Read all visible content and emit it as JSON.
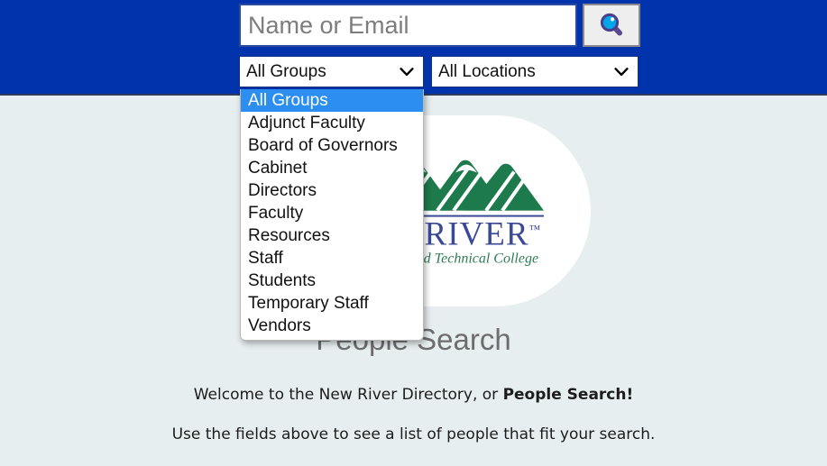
{
  "theme": {
    "header_bg": "#0033ac",
    "body_bg": "#e7eef0",
    "highlight_blue": "#2b8ef0",
    "logo_green": "#1d7a4c",
    "logo_navy": "#3b4a96",
    "title_grey": "#6d6d6d"
  },
  "search": {
    "placeholder": "Name or Email",
    "value": "",
    "button_icon": "magnifier-icon"
  },
  "filters": {
    "groups": {
      "selected": "All Groups",
      "expanded": true,
      "options": [
        "All Groups",
        "Adjunct Faculty",
        "Board of Governors",
        "Cabinet",
        "Directors",
        "Faculty",
        "Resources",
        "Staff",
        "Students",
        "Temporary Staff",
        "Vendors"
      ]
    },
    "locations": {
      "selected": "All Locations",
      "expanded": false,
      "options": [
        "All Locations"
      ]
    }
  },
  "logo": {
    "icon": "mountain-range-icon",
    "wordmark": "NEW RIVER",
    "trademark": "™",
    "tagline": "Community and Technical College"
  },
  "main": {
    "title": "People Search",
    "intro_prefix": "Welcome to the New River Directory, or ",
    "intro_emphasis": "People Search!",
    "instructions": "Use the fields above to see a list of people that fit your search."
  }
}
